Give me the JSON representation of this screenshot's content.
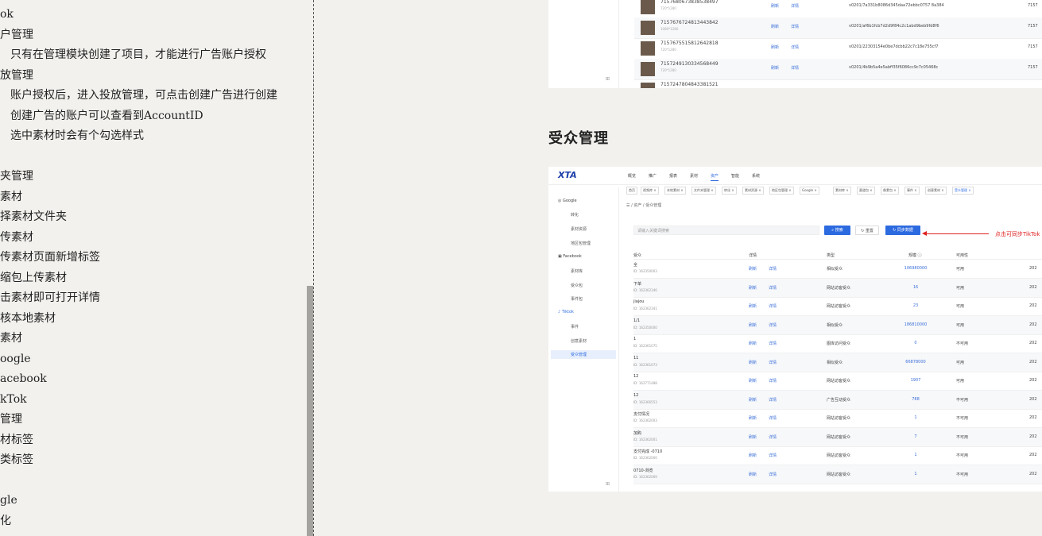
{
  "outline": {
    "items": [
      {
        "text": "ok",
        "indent": 0
      },
      {
        "text": "户管理",
        "indent": 0
      },
      {
        "text": "只有在管理模块创建了项目，才能进行广告账户授权",
        "indent": 1
      },
      {
        "text": "放管理",
        "indent": 0
      },
      {
        "text": "账户授权后，进入投放管理，可点击创建广告进行创建",
        "indent": 1
      },
      {
        "text": "创建广告的账户可以查看到AccountID",
        "indent": 1
      },
      {
        "text": "选中素材时会有个勾选样式",
        "indent": 1
      },
      {
        "text": "",
        "indent": 0
      },
      {
        "text": "夹管理",
        "indent": 0
      },
      {
        "text": "素材",
        "indent": 0
      },
      {
        "text": "择素材文件夹",
        "indent": 0
      },
      {
        "text": "传素材",
        "indent": 0
      },
      {
        "text": "传素材页面新增标签",
        "indent": 0
      },
      {
        "text": "缩包上传素材",
        "indent": 0
      },
      {
        "text": "击素材即可打开详情",
        "indent": 0
      },
      {
        "text": "核本地素材",
        "indent": 0
      },
      {
        "text": "素材",
        "indent": 0
      },
      {
        "text": "oogle",
        "indent": 0
      },
      {
        "text": "acebook",
        "indent": 0
      },
      {
        "text": "kTok",
        "indent": 0
      },
      {
        "text": "管理",
        "indent": 0
      },
      {
        "text": "材标签",
        "indent": 0
      },
      {
        "text": "类标签",
        "indent": 0
      },
      {
        "text": "",
        "indent": 0
      },
      {
        "text": "gle",
        "indent": 0
      },
      {
        "text": "化",
        "indent": 0
      }
    ]
  },
  "section_title": "受众管理",
  "shot1": {
    "rows": [
      {
        "id": "7157680673838538497",
        "sub": "720*1280",
        "action1": "刷新",
        "action2": "详情",
        "url": "v0201/7a331b8086d345daa72ebbc0757 8a384",
        "last": "7157"
      },
      {
        "id": "7157676724813443842",
        "sub": "1080*1280",
        "action1": "刷新",
        "action2": "详情",
        "url": "v0201/af6b1fcb7d2d9f84c2c1abd9beb9fd8f6",
        "last": "7157"
      },
      {
        "id": "7157675515812642818",
        "sub": "720*1280",
        "action1": "刷新",
        "action2": "详情",
        "url": "v0201/22303154e0be7dcbb22c7c18e755cf7",
        "last": "7157"
      },
      {
        "id": "7157249130334568449",
        "sub": "720*1280",
        "action1": "刷新",
        "action2": "详情",
        "url": "v0201/4b9b5a4e5abff35f6086cc9c7c05468c",
        "last": "7157"
      },
      {
        "id": "7157247804843381521",
        "sub": "",
        "action1": "",
        "action2": "",
        "url": "",
        "last": ""
      }
    ]
  },
  "shot2": {
    "logo": "XTA",
    "nav": [
      "概览",
      "推广",
      "报表",
      "素材",
      "资产",
      "智能",
      "系统"
    ],
    "nav_active_index": 4,
    "tags": [
      "首页",
      "视频库 ×",
      "本地素材 ×",
      "文件夹管理 ×",
      "转化 ×",
      "素材资源 ×",
      "地区包管理 ×",
      "Google ×",
      "素材库 ×",
      "渠道包 ×",
      "像素包 ×",
      "事件 ×",
      "创意素材 ×",
      "受众管理 ×"
    ],
    "sidebar": {
      "google_label": "Google",
      "google_items": [
        "转化",
        "素材资源",
        "地区包管理"
      ],
      "facebook_label": "Facebook",
      "facebook_items": [
        "素材库",
        "受众包",
        "事件包"
      ],
      "tiktok_label": "Tiktok",
      "tiktok_items": [
        "事件",
        "创意素材",
        "受众管理"
      ],
      "selected": "受众管理"
    },
    "breadcrumb": "☰  /  资产  /  受众管理",
    "search_placeholder": "请输入关键词搜索",
    "btn_search": "搜索",
    "btn_reset": "重置",
    "btn_sync": "同步数据",
    "annotation": "点击可同步TikTok",
    "table_headers": [
      "受众",
      "详情",
      "类型",
      "规模 ⓘ",
      "可用性"
    ],
    "rows": [
      {
        "name": "全",
        "id": "ID: 162350003",
        "refresh": "刷新",
        "detail": "详情",
        "type": "相似受众",
        "size": "106980000",
        "avail": "可用",
        "year": "202"
      },
      {
        "name": "下单",
        "id": "ID: 162362346",
        "refresh": "刷新",
        "detail": "详情",
        "type": "网站访客受众",
        "size": "16",
        "avail": "可用",
        "year": "202"
      },
      {
        "name": "jiajou",
        "id": "ID: 162362341",
        "refresh": "刷新",
        "detail": "详情",
        "type": "网站访客受众",
        "size": "23",
        "avail": "可用",
        "year": "202"
      },
      {
        "name": "1/1",
        "id": "ID: 162350000",
        "refresh": "刷新",
        "detail": "详情",
        "type": "相似受众",
        "size": "186810000",
        "avail": "可用",
        "year": "202"
      },
      {
        "name": "1",
        "id": "ID: 162361075",
        "refresh": "刷新",
        "detail": "详情",
        "type": "图库访问受众",
        "size": "0",
        "avail": "不可用",
        "year": "202"
      },
      {
        "name": "11",
        "id": "ID: 162361073",
        "refresh": "刷新",
        "detail": "详情",
        "type": "相似受众",
        "size": "66878000",
        "avail": "可用",
        "year": "202"
      },
      {
        "name": "12",
        "id": "ID: 162771488",
        "refresh": "刷新",
        "detail": "详情",
        "type": "网站访客受众",
        "size": "1907",
        "avail": "可用",
        "year": "202"
      },
      {
        "name": "12",
        "id": "ID: 162366553",
        "refresh": "刷新",
        "detail": "详情",
        "type": "广告互动受众",
        "size": "788",
        "avail": "不可用",
        "year": "202"
      },
      {
        "name": "支付情况",
        "id": "ID: 162362003",
        "refresh": "刷新",
        "detail": "详情",
        "type": "网站访客受众",
        "size": "1",
        "avail": "不可用",
        "year": "202"
      },
      {
        "name": "加购",
        "id": "ID: 162362001",
        "refresh": "刷新",
        "detail": "详情",
        "type": "网站访客受众",
        "size": "7",
        "avail": "不可用",
        "year": "202"
      },
      {
        "name": "支付完成 -0710",
        "id": "ID: 162362000",
        "refresh": "刷新",
        "detail": "详情",
        "type": "网站访客受众",
        "size": "1",
        "avail": "不可用",
        "year": "202"
      },
      {
        "name": "0710-浏览",
        "id": "ID: 162362009",
        "refresh": "刷新",
        "detail": "详情",
        "type": "网站访客受众",
        "size": "1",
        "avail": "不可用",
        "year": "202"
      }
    ]
  }
}
